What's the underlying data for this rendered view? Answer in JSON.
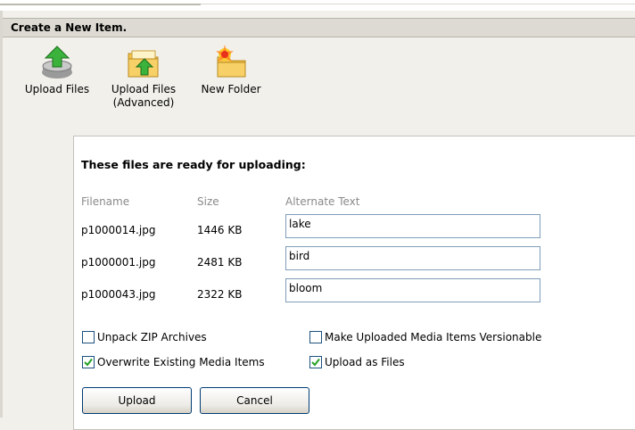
{
  "header": {
    "title": "Create a New Item."
  },
  "toolbar": {
    "items": [
      {
        "icon": "upload-arrow-icon",
        "label": "Upload Files"
      },
      {
        "icon": "folder-upload-icon",
        "label": "Upload Files",
        "label2": "(Advanced)"
      },
      {
        "icon": "new-folder-icon",
        "label": "New Folder"
      }
    ]
  },
  "upload": {
    "heading": "These files are ready for uploading:",
    "columns": {
      "filename": "Filename",
      "size": "Size",
      "alt": "Alternate Text"
    },
    "files": [
      {
        "filename": "p1000014.jpg",
        "size": "1446 KB",
        "alt": "lake"
      },
      {
        "filename": "p1000001.jpg",
        "size": "2481 KB",
        "alt": "bird"
      },
      {
        "filename": "p1000043.jpg",
        "size": "2322 KB",
        "alt": "bloom"
      }
    ],
    "options": {
      "unpack_zip": {
        "label": "Unpack ZIP Archives",
        "checked": false
      },
      "versionable": {
        "label": "Make Uploaded Media Items Versionable",
        "checked": false
      },
      "overwrite": {
        "label": "Overwrite Existing Media Items",
        "checked": true
      },
      "as_files": {
        "label": "Upload as Files",
        "checked": true
      }
    },
    "buttons": {
      "upload": "Upload",
      "cancel": "Cancel"
    }
  },
  "colors": {
    "check": "#21a121",
    "header_bg": "#dcdad2",
    "input_border": "#7f9db9"
  }
}
